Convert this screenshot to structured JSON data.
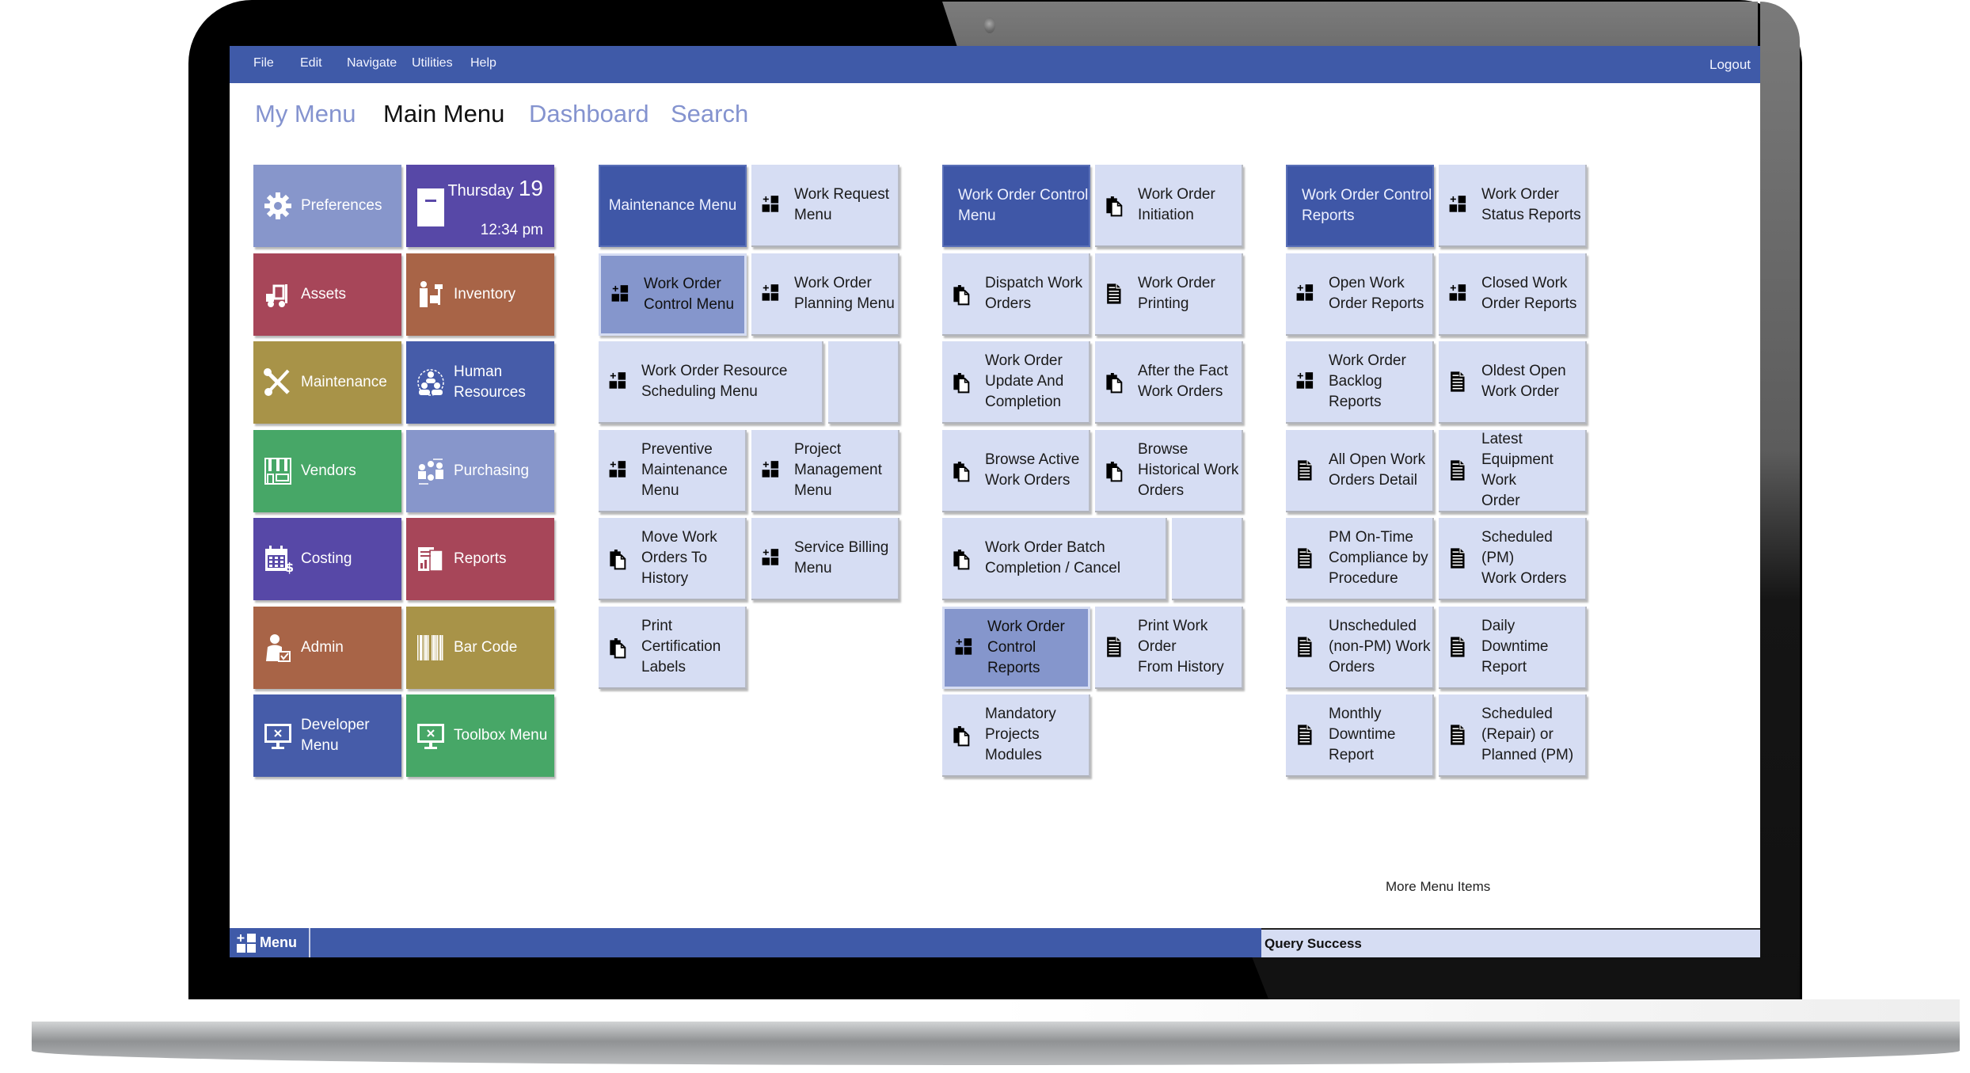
{
  "menubar": {
    "items": [
      "File",
      "Edit",
      "Navigate",
      "Utilities",
      "Help"
    ],
    "logout": "Logout"
  },
  "tabs": [
    {
      "label": "My Menu",
      "active": false
    },
    {
      "label": "Main Menu",
      "active": true
    },
    {
      "label": "Dashboard",
      "active": false
    },
    {
      "label": "Search",
      "active": false
    }
  ],
  "datetime": {
    "weekday": "Thursday",
    "day": "19",
    "time": "12:34 pm"
  },
  "modules": [
    {
      "label": "Preferences",
      "icon": "gear-icon",
      "color": "#8796cb"
    },
    {
      "label": "Assets",
      "icon": "forklift-icon",
      "color": "#a74659"
    },
    {
      "label": "Inventory",
      "icon": "warehouse-worker-icon",
      "color": "#a86447"
    },
    {
      "label": "Maintenance",
      "icon": "wrench-screwdriver-icon",
      "color": "#a89348"
    },
    {
      "label": "Human\nResources",
      "icon": "people-group-icon",
      "color": "#465ca9"
    },
    {
      "label": "Vendors",
      "icon": "storefront-icon",
      "color": "#47a767"
    },
    {
      "label": "Purchasing",
      "icon": "purchasing-people-icon",
      "color": "#8796cb"
    },
    {
      "label": "Costing",
      "icon": "calendar-dollar-icon",
      "color": "#5748a7"
    },
    {
      "label": "Reports",
      "icon": "report-documents-icon",
      "color": "#a74659"
    },
    {
      "label": "Admin",
      "icon": "admin-user-check-icon",
      "color": "#a86447"
    },
    {
      "label": "Bar Code",
      "icon": "barcode-icon",
      "color": "#a89348"
    },
    {
      "label": "Developer\nMenu",
      "icon": "monitor-x-icon",
      "color": "#465ca9"
    },
    {
      "label": "Toolbox Menu",
      "icon": "monitor-x-icon",
      "color": "#47a767"
    }
  ],
  "datetime_color": "#5748a7",
  "maintenance_menu": {
    "header": "Maintenance Menu",
    "items": [
      {
        "label": "Work Request\nMenu",
        "icon": "submenu-grid-icon"
      },
      {
        "label": "Work Order\nControl Menu",
        "icon": "submenu-grid-icon",
        "selected": true
      },
      {
        "label": "Work Order\nPlanning Menu",
        "icon": "submenu-grid-icon"
      },
      {
        "label": "Work Order Resource\nScheduling Menu",
        "icon": "submenu-grid-icon"
      },
      {
        "label": "Preventive\nMaintenance\nMenu",
        "icon": "submenu-grid-icon"
      },
      {
        "label": "Project\nManagement\nMenu",
        "icon": "submenu-grid-icon"
      },
      {
        "label": "Move Work\nOrders To\nHistory",
        "icon": "clipboard-copy-icon"
      },
      {
        "label": "Service Billing\nMenu",
        "icon": "submenu-grid-icon"
      },
      {
        "label": "Print\nCertification\nLabels",
        "icon": "clipboard-copy-icon"
      }
    ]
  },
  "work_order_control_menu": {
    "header": "Work Order Control\nMenu",
    "items": [
      {
        "label": "Work Order\nInitiation",
        "icon": "clipboard-copy-icon"
      },
      {
        "label": "Dispatch Work\nOrders",
        "icon": "clipboard-copy-icon"
      },
      {
        "label": "Work Order\nPrinting",
        "icon": "document-icon"
      },
      {
        "label": "Work Order\nUpdate And\nCompletion",
        "icon": "clipboard-copy-icon"
      },
      {
        "label": "After the Fact\nWork Orders",
        "icon": "clipboard-copy-icon"
      },
      {
        "label": "Browse Active\nWork Orders",
        "icon": "clipboard-copy-icon"
      },
      {
        "label": "Browse\nHistorical Work\nOrders",
        "icon": "clipboard-copy-icon"
      },
      {
        "label": "Work Order Batch\nCompletion / Cancel",
        "icon": "clipboard-copy-icon"
      },
      {
        "label": "Work Order\nControl Reports",
        "icon": "submenu-grid-icon",
        "selected": true
      },
      {
        "label": "Print Work Order\nFrom History",
        "icon": "document-icon"
      },
      {
        "label": "Mandatory\nProjects\nModules",
        "icon": "clipboard-copy-icon"
      }
    ]
  },
  "work_order_control_reports": {
    "header": "Work Order Control\nReports",
    "items": [
      {
        "label": "Work Order\nStatus Reports",
        "icon": "submenu-grid-icon"
      },
      {
        "label": "Open Work\nOrder Reports",
        "icon": "submenu-grid-icon"
      },
      {
        "label": "Closed Work\nOrder Reports",
        "icon": "submenu-grid-icon"
      },
      {
        "label": "Work Order\nBacklog Reports",
        "icon": "submenu-grid-icon"
      },
      {
        "label": "Oldest Open\nWork Order",
        "icon": "document-icon"
      },
      {
        "label": "All Open Work\nOrders Detail",
        "icon": "document-icon"
      },
      {
        "label": "Latest\nEquipment Work\nOrder",
        "icon": "document-icon"
      },
      {
        "label": "PM On-Time\nCompliance by\nProcedure",
        "icon": "document-icon"
      },
      {
        "label": "Scheduled (PM)\nWork Orders",
        "icon": "document-icon"
      },
      {
        "label": "Unscheduled\n(non-PM) Work\nOrders",
        "icon": "document-icon"
      },
      {
        "label": "Daily Downtime\nReport",
        "icon": "document-icon"
      },
      {
        "label": "Monthly\nDowntime\nReport",
        "icon": "document-icon"
      },
      {
        "label": "Scheduled\n(Repair) or\nPlanned (PM)",
        "icon": "document-icon"
      }
    ]
  },
  "more_menu_items": "More Menu Items",
  "statusbar": {
    "menu_label": "Menu",
    "message": "Query Success"
  },
  "colors": {
    "brand": "#3f5aa8",
    "submenu_tile": "#d6ddf3",
    "selected_tile": "#8596cc"
  }
}
